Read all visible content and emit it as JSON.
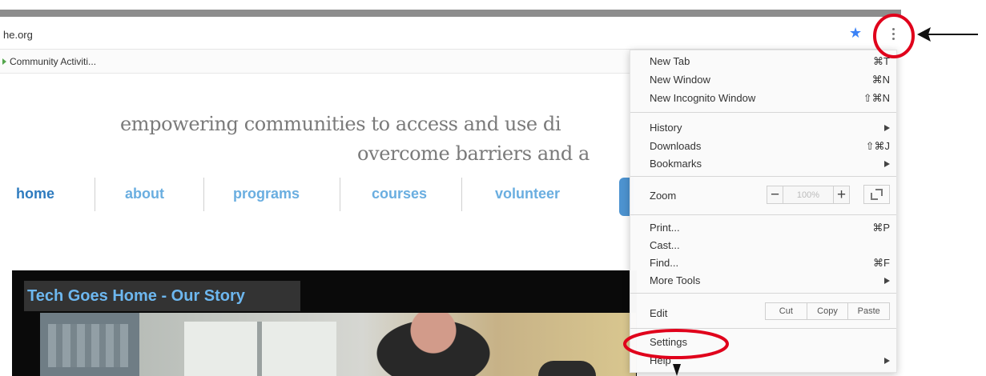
{
  "browser": {
    "url": "he.org",
    "bookmark": "Community Activiti..."
  },
  "page": {
    "tagline_line1": "empowering communities to access and use di",
    "tagline_line2": "overcome barriers and a",
    "nav": {
      "home": "home",
      "about": "about",
      "programs": "programs",
      "courses": "courses",
      "volunteer": "volunteer"
    },
    "video_title": "Tech Goes Home - Our Story"
  },
  "menu": {
    "new_tab": "New Tab",
    "new_tab_shortcut": "⌘T",
    "new_window": "New Window",
    "new_window_shortcut": "⌘N",
    "new_incognito": "New Incognito Window",
    "new_incognito_shortcut": "⇧⌘N",
    "history": "History",
    "downloads": "Downloads",
    "downloads_shortcut": "⇧⌘J",
    "bookmarks": "Bookmarks",
    "zoom": "Zoom",
    "zoom_minus": "−",
    "zoom_value": "100%",
    "zoom_plus": "+",
    "print": "Print...",
    "print_shortcut": "⌘P",
    "cast": "Cast...",
    "find": "Find...",
    "find_shortcut": "⌘F",
    "more_tools": "More Tools",
    "edit": "Edit",
    "cut": "Cut",
    "copy": "Copy",
    "paste": "Paste",
    "settings": "Settings",
    "help": "Help"
  },
  "icons": {
    "bookmark": "star-icon",
    "menu": "kebab-icon",
    "fullscreen": "fullscreen-icon"
  },
  "colors": {
    "nav_home": "#2e7bbf",
    "nav_link": "#6aaee0",
    "annotation": "#e0001b"
  }
}
